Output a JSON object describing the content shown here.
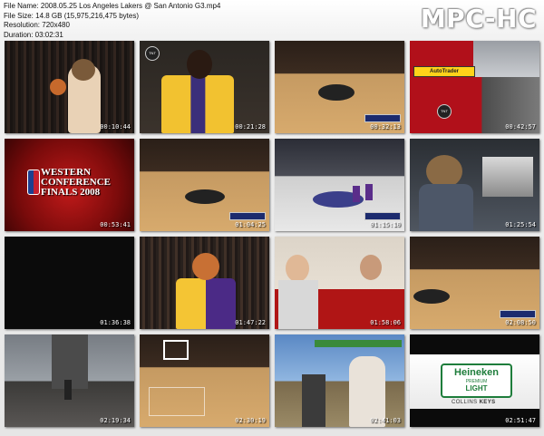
{
  "header": {
    "file_name": "File Name: 2008.05.25 Los Angeles Lakers @ San Antonio G3.mp4",
    "file_size": "File Size: 14.8 GB (15,975,216,475 bytes)",
    "resolution": "Resolution: 720x480",
    "duration": "Duration: 03:02:31"
  },
  "logo_text": "MPC-HC",
  "thumbnails": [
    {
      "timestamp": "00:10:44"
    },
    {
      "timestamp": "00:21:28"
    },
    {
      "timestamp": "00:32:13"
    },
    {
      "timestamp": "00:42:57"
    },
    {
      "timestamp": "00:53:41"
    },
    {
      "timestamp": "01:04:25"
    },
    {
      "timestamp": "01:15:10"
    },
    {
      "timestamp": "01:25:54"
    },
    {
      "timestamp": "01:36:38"
    },
    {
      "timestamp": "01:47:22"
    },
    {
      "timestamp": "01:58:06"
    },
    {
      "timestamp": "02:08:50"
    },
    {
      "timestamp": "02:19:34"
    },
    {
      "timestamp": "02:30:19"
    },
    {
      "timestamp": "02:41:03"
    },
    {
      "timestamp": "02:51:47"
    }
  ],
  "overlays": {
    "western_conference": "WESTERN CONFERENCE FINALS 2008",
    "autotrader": "AutoTrader",
    "tnt": "TNT",
    "heineken": "Heineken",
    "heineken_premium": "PREMIUM",
    "heineken_light": "LIGHT",
    "collins": "COLLINS",
    "keys": "KEYS"
  }
}
